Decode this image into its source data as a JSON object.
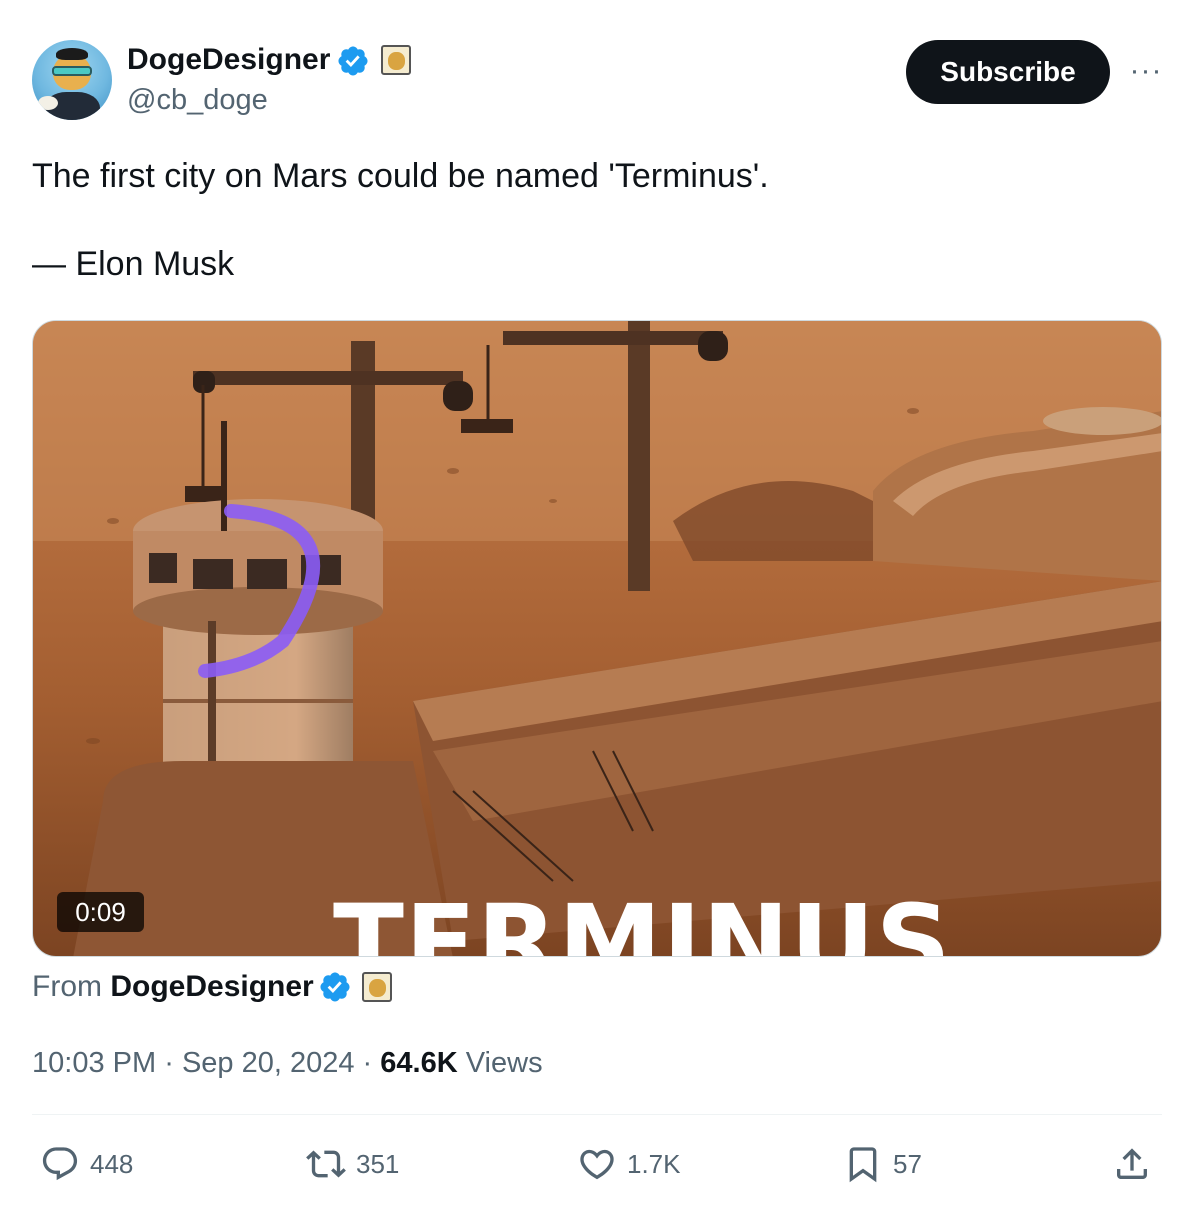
{
  "author": {
    "name": "DogeDesigner",
    "handle": "@cb_doge",
    "verified_color": "#1d9bf0"
  },
  "header": {
    "subscribe_label": "Subscribe",
    "more_label": "···"
  },
  "tweet": {
    "text": "The first city on Mars could be named 'Terminus'.\n\n— Elon Musk"
  },
  "media": {
    "title_overlay": "TERMINUS",
    "duration": "0:09",
    "from_label": "From",
    "from_name": "DogeDesigner"
  },
  "meta": {
    "time": "10:03 PM",
    "separator1": "·",
    "date": "Sep 20, 2024",
    "separator2": "·",
    "views_count": "64.6K",
    "views_label": "Views"
  },
  "actions": {
    "replies": "448",
    "reposts": "351",
    "likes": "1.7K",
    "bookmarks": "57"
  },
  "icons": {
    "reply": "reply-icon",
    "repost": "repost-icon",
    "like": "heart-icon",
    "bookmark": "bookmark-icon",
    "share": "share-icon"
  }
}
